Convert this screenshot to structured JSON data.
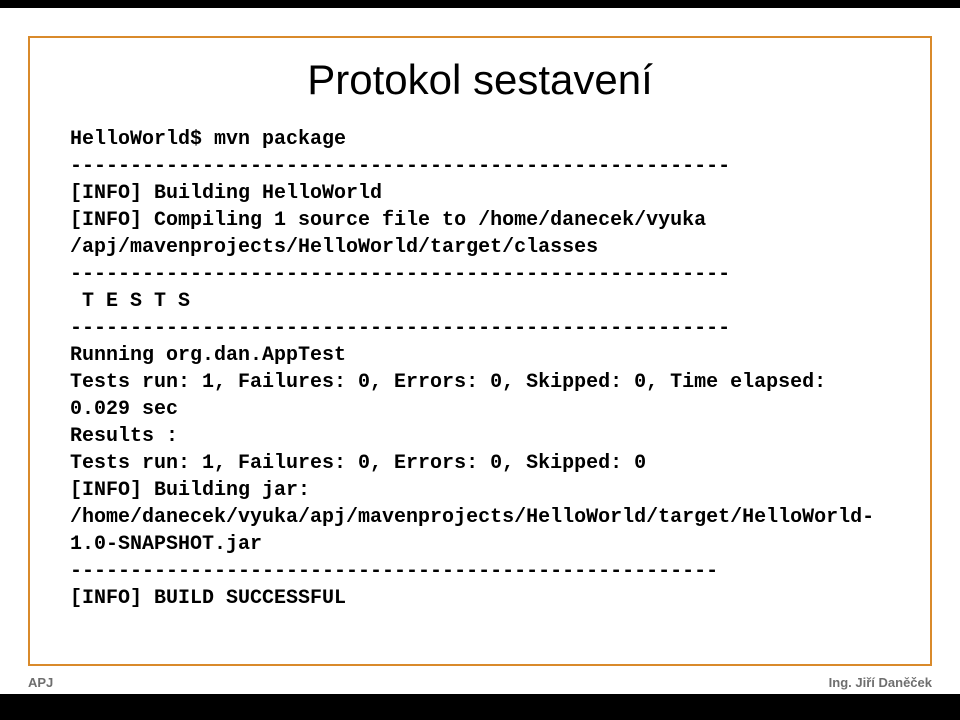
{
  "title": "Protokol sestavení",
  "code": "HelloWorld$ mvn package\n-------------------------------------------------------\n[INFO] Building HelloWorld\n[INFO] Compiling 1 source file to /home/danecek/vyuka\n/apj/mavenprojects/HelloWorld/target/classes\n-------------------------------------------------------\n T E S T S\n-------------------------------------------------------\nRunning org.dan.AppTest\nTests run: 1, Failures: 0, Errors: 0, Skipped: 0, Time elapsed: 0.029 sec\nResults :\nTests run: 1, Failures: 0, Errors: 0, Skipped: 0\n[INFO] Building jar:\n/home/danecek/vyuka/apj/mavenprojects/HelloWorld/target/HelloWorld-1.0-SNAPSHOT.jar\n------------------------------------------------------\n[INFO] BUILD SUCCESSFUL",
  "footer": {
    "left": "APJ",
    "right": "Ing. Jiří Daněček"
  }
}
